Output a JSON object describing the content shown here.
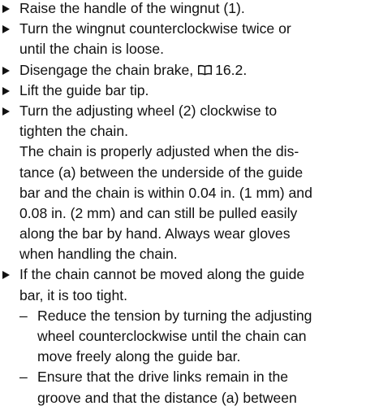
{
  "steps": [
    {
      "lines": [
        "Raise the handle of the wingnut (1)."
      ]
    },
    {
      "lines": [
        "Turn the wingnut counterclockwise twice or",
        "until the chain is loose."
      ]
    },
    {
      "text_before_icon": "Disengage the chain brake, ",
      "icon": "book-icon",
      "text_after_icon": "16.2."
    },
    {
      "lines": [
        "Lift the guide bar tip."
      ]
    },
    {
      "lines": [
        "Turn the adjusting wheel (2) clockwise to",
        "tighten the chain.",
        "The chain is properly adjusted when the dis-",
        "tance (a) between the underside of the guide",
        "bar and the chain is within 0.04 in. (1 mm) and",
        "0.08 in. (2 mm) and can still be pulled easily",
        "along the bar by hand. Always wear gloves",
        "when handling the chain."
      ]
    },
    {
      "lines": [
        "If the chain cannot be moved along the guide",
        "bar, it is too tight."
      ],
      "subitems": [
        {
          "lines": [
            "Reduce the tension by turning the adjusting",
            "wheel counterclockwise until the chain can",
            "move freely along the guide bar."
          ]
        },
        {
          "lines": [
            "Ensure that the drive links remain in the",
            "groove and that the distance (a) between"
          ]
        }
      ]
    }
  ],
  "bullet_symbol": "►",
  "dash_symbol": "–"
}
